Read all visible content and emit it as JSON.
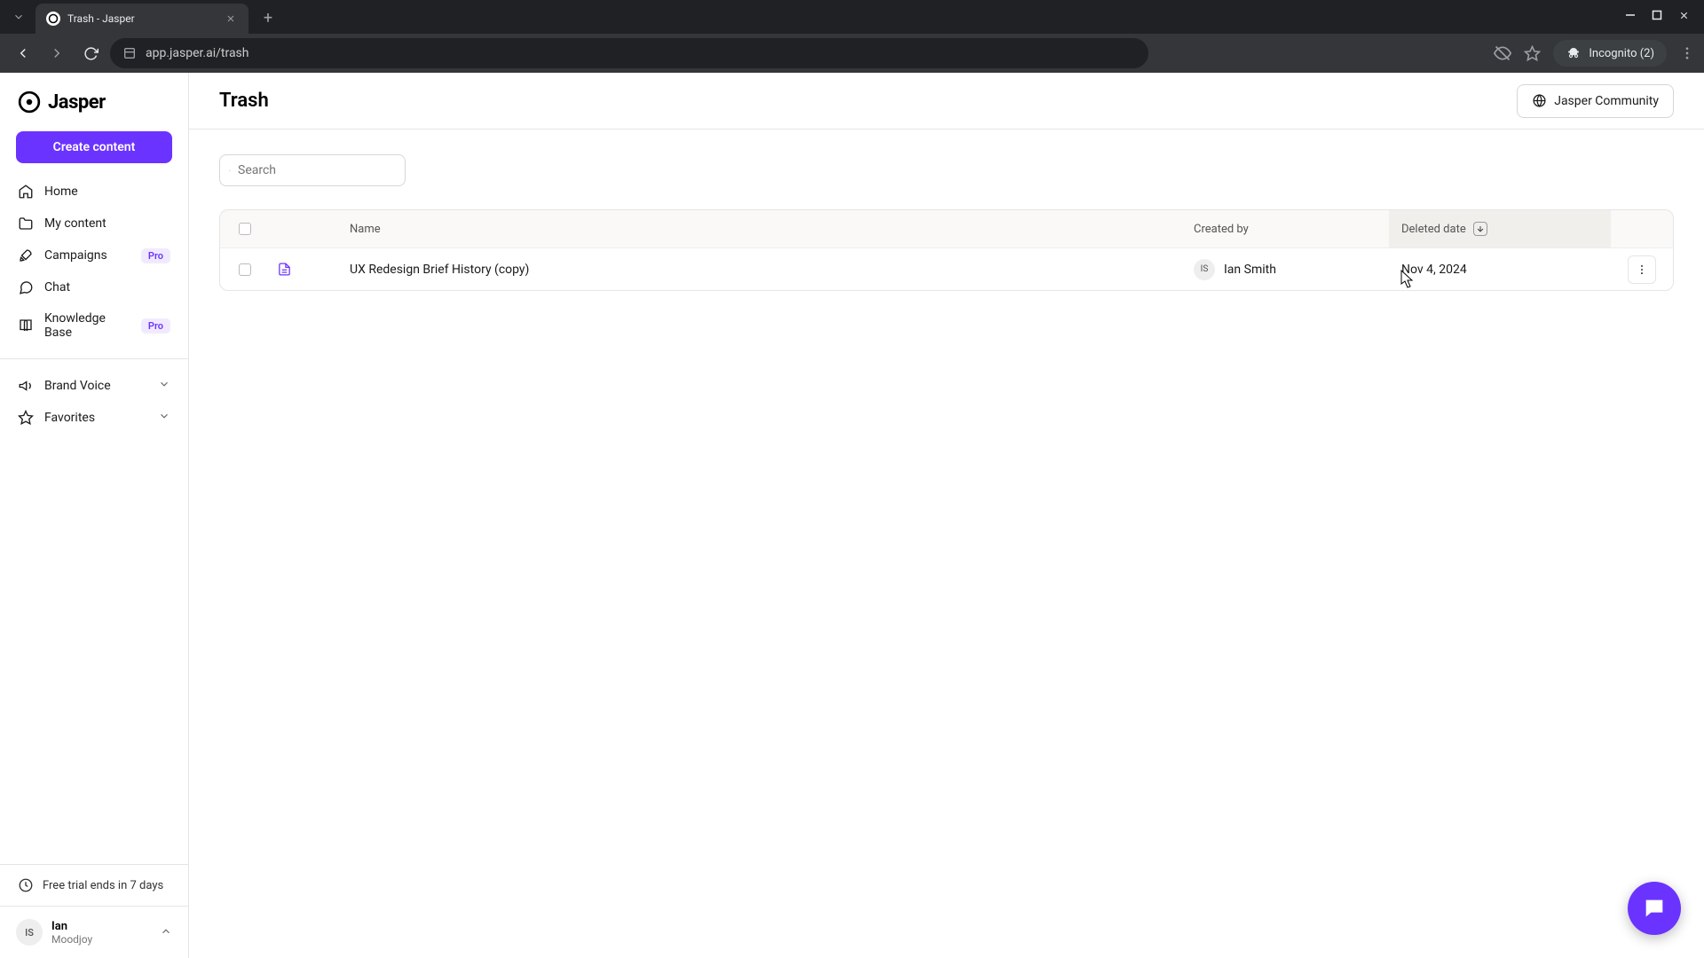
{
  "browser": {
    "tab_title": "Trash - Jasper",
    "url_display": "app.jasper.ai/trash",
    "incognito_label": "Incognito (2)"
  },
  "sidebar": {
    "logo_text": "Jasper",
    "create_label": "Create content",
    "items": [
      {
        "label": "Home"
      },
      {
        "label": "My content"
      },
      {
        "label": "Campaigns",
        "badge": "Pro"
      },
      {
        "label": "Chat"
      },
      {
        "label": "Knowledge Base",
        "badge": "Pro"
      }
    ],
    "sections": [
      {
        "label": "Brand Voice"
      },
      {
        "label": "Favorites"
      }
    ],
    "trial_text": "Free trial ends in 7 days",
    "user": {
      "initials": "IS",
      "name": "Ian",
      "org": "Moodjoy"
    }
  },
  "header": {
    "title": "Trash",
    "community_label": "Jasper Community"
  },
  "search": {
    "placeholder": "Search"
  },
  "table": {
    "columns": {
      "name": "Name",
      "created_by": "Created by",
      "deleted_date": "Deleted date"
    },
    "rows": [
      {
        "name": "UX Redesign Brief History (copy)",
        "creator_initials": "IS",
        "creator_name": "Ian Smith",
        "deleted_date": "Nov 4, 2024"
      }
    ]
  }
}
